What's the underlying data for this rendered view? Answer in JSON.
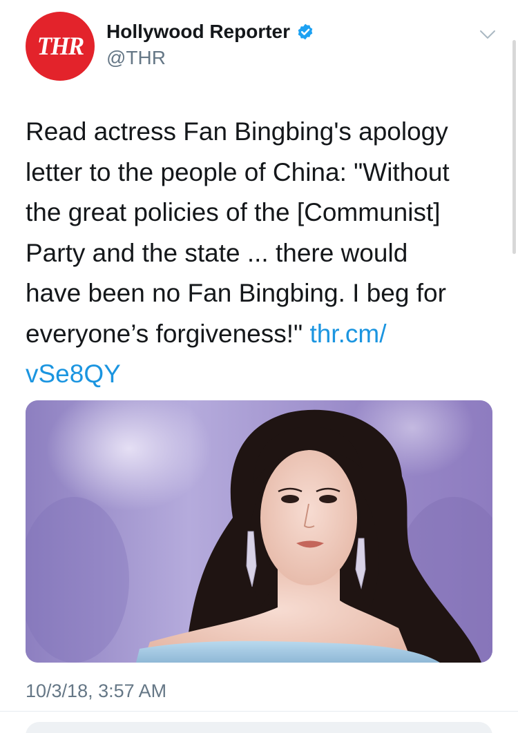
{
  "tweet": {
    "avatar_text": "THR",
    "display_name": "Hollywood Reporter",
    "handle": "@THR",
    "text_lines": [
      "Read actress Fan Bingbing's apology",
      "letter to the people of China: \"Without",
      "the great policies of the [Communist]",
      "Party and the state ... there would",
      "have been no Fan Bingbing. I beg for",
      "everyone’s forgiveness!\" "
    ],
    "link_part1": "thr.cm/",
    "link_part2": "vSe8QY",
    "timestamp": "10/3/18, 3:57 AM"
  },
  "icons": {
    "verified": "verified-badge-icon",
    "caret": "chevron-down-icon"
  },
  "colors": {
    "brand_red": "#e3232b",
    "link_blue": "#1b95e0",
    "verified_blue": "#1da1f2",
    "secondary_text": "#657786"
  }
}
